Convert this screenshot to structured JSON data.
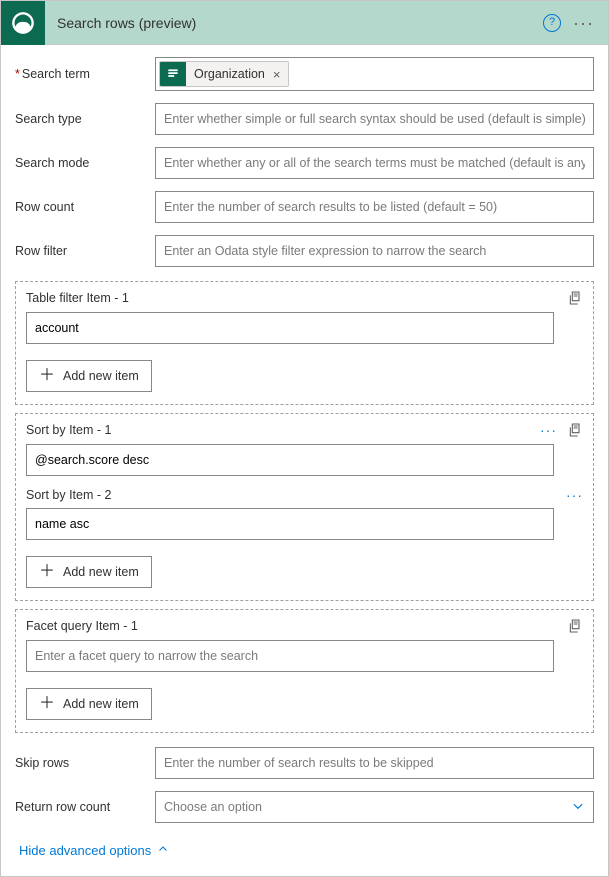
{
  "header": {
    "title": "Search rows (preview)"
  },
  "labels": {
    "search_term": "Search term",
    "search_type": "Search type",
    "search_mode": "Search mode",
    "row_count": "Row count",
    "row_filter": "Row filter",
    "skip_rows": "Skip rows",
    "return_row_count": "Return row count"
  },
  "values": {
    "search_term_token": "Organization",
    "table_filter_1": "account",
    "sort_by_1": "@search.score desc",
    "sort_by_2": "name asc",
    "facet_1": "",
    "return_row_count": "Choose an option"
  },
  "placeholders": {
    "search_type": "Enter whether simple or full search syntax should be used (default is simple)",
    "search_mode": "Enter whether any or all of the search terms must be matched (default is any)",
    "row_count": "Enter the number of search results to be listed (default = 50)",
    "row_filter": "Enter an Odata style filter expression to narrow the search",
    "facet_1": "Enter a facet query to narrow the search",
    "skip_rows": "Enter the number of search results to be skipped"
  },
  "groups": {
    "table_filter_1": "Table filter Item - 1",
    "sort_by_1": "Sort by Item - 1",
    "sort_by_2": "Sort by Item - 2",
    "facet_1": "Facet query Item - 1"
  },
  "buttons": {
    "add_new_item": "Add new item"
  },
  "links": {
    "hide_advanced": "Hide advanced options"
  }
}
